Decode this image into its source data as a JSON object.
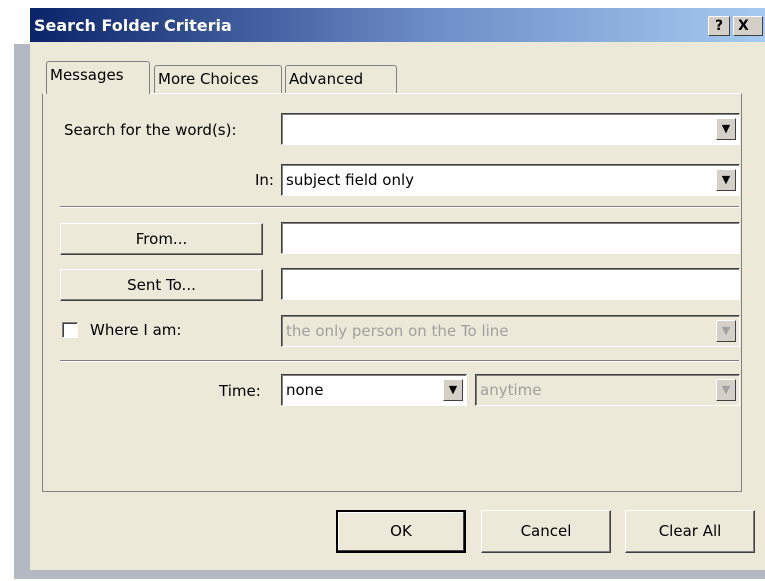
{
  "window": {
    "title": "Search Folder Criteria",
    "help_label": "?",
    "close_label": "X"
  },
  "tabs": [
    {
      "label": "Messages",
      "active": true
    },
    {
      "label": "More Choices",
      "active": false
    },
    {
      "label": "Advanced",
      "active": false
    }
  ],
  "search": {
    "label": "Search for the word(s):",
    "value": ""
  },
  "in": {
    "label": "In:",
    "value": "subject field only"
  },
  "from": {
    "button_label": "From...",
    "value": ""
  },
  "sent_to": {
    "button_label": "Sent To...",
    "value": ""
  },
  "where_i_am": {
    "label": "Where I am:",
    "checked": false,
    "value": "the only person on the To line"
  },
  "time": {
    "label": "Time:",
    "value": "none",
    "range_value": "anytime"
  },
  "buttons": {
    "ok": "OK",
    "cancel": "Cancel",
    "clear_all": "Clear All"
  },
  "icons": {
    "dropdown_arrow": "▼"
  }
}
